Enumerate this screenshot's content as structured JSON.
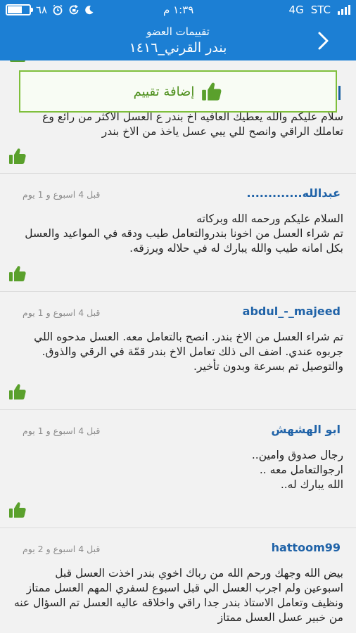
{
  "status_bar": {
    "battery_percent_label": "٦٨",
    "battery_level": 0.68,
    "time": "١:٣٩ م",
    "network": "4G",
    "carrier": "STC"
  },
  "header": {
    "subtitle": "تقييمات العضو",
    "title": "بندر القرني_١٤١٦"
  },
  "add_rating": {
    "label": "إضافة تقييم"
  },
  "previous_review": {
    "text": "سلام عليكم والله يعطيك العافيه اخ بندر ع العسل الاكثر من رائع وع تعاملك الراقي وانصح للي يبي عسل ياخذ من الاخ بندر"
  },
  "reviews": [
    {
      "name": "عبدالله.............",
      "time": "قبل 4 اسبوع و 1 يوم",
      "lines": [
        "السلام عليكم ورحمه الله وبركاته",
        "تم شراء العسل من اخونا بندروالتعامل طيب ودقه في المواعيد والعسل بكل امانه طيب والله يبارك له في حلاله ويرزقه."
      ]
    },
    {
      "name": "abdul_-_majeed",
      "time": "قبل 4 اسبوع و 1 يوم",
      "lines": [
        "تم شراء العسل من الاخ بندر. انصح بالتعامل معه. العسل مدحوه اللي جربوه عندي. اضف الى ذلك تعامل الاخ بندر قمّة في الرقي والذوق. والتوصيل تم بسرعة وبدون تأخير."
      ]
    },
    {
      "name": "ابو الهشهش",
      "time": "قبل 4 اسبوع و 1 يوم",
      "lines": [
        "رجال صدوق وامين..",
        "ارجوالتعامل معه ..",
        "الله يبارك له.."
      ]
    },
    {
      "name": "hattoom99",
      "time": "قبل 4 اسبوع و 2 يوم",
      "lines": [
        "بيض الله وجهك ورحم الله من رباك اخوي بندر  اخذت العسل قبل اسبوعين  ولم اجرب العسل الي قبل اسبوع لسفري المهم العسل ممتاز ونظيف وتعامل الاستاذ بندر جدا راقي واخلاقه عاليه العسل تم السؤال عنه من خبير عسل العسل ممتاز"
      ]
    }
  ],
  "colors": {
    "header_bg": "#1c7fd4",
    "accent_green": "#4d8f1c",
    "name_blue": "#2063a8"
  }
}
